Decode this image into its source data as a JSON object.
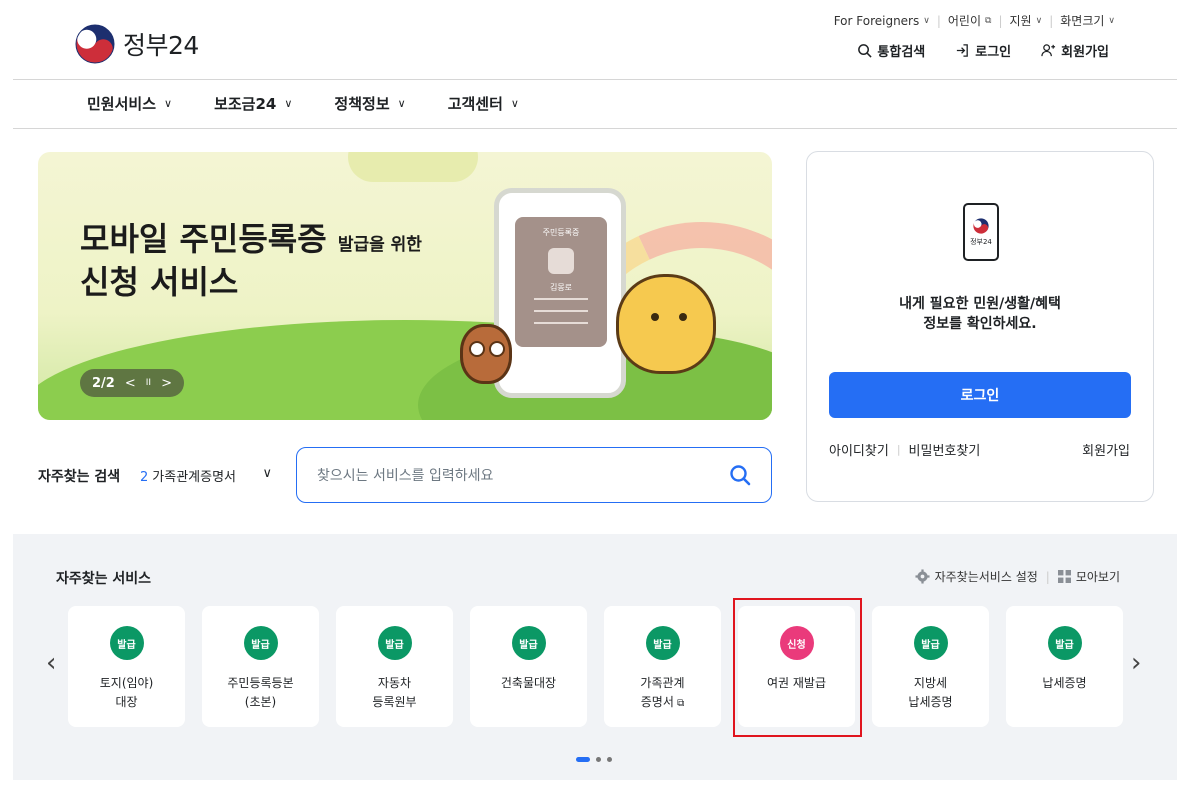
{
  "header": {
    "logo_text": "정부24",
    "util_links": [
      {
        "label": "For Foreigners",
        "suffix": "∨"
      },
      {
        "label": "어린이",
        "suffix": "⧉"
      },
      {
        "label": "지원",
        "suffix": "∨"
      },
      {
        "label": "화면크기",
        "suffix": "∨"
      }
    ],
    "actions": [
      {
        "label": "통합검색",
        "icon": "search-icon"
      },
      {
        "label": "로그인",
        "icon": "login-icon"
      },
      {
        "label": "회원가입",
        "icon": "user-plus-icon"
      }
    ]
  },
  "nav": [
    {
      "label": "민원서비스"
    },
    {
      "label": "보조금24"
    },
    {
      "label": "정책정보"
    },
    {
      "label": "고객센터"
    }
  ],
  "banner": {
    "title_line1": "모바일 주민등록증",
    "title_line1_small": "발급을 위한",
    "title_line2": "신청 서비스",
    "card_title": "주민등록증",
    "card_name": "김몽로",
    "slide_counter": "2/2",
    "prev_symbol": "<",
    "pause_symbol": "II",
    "next_symbol": ">"
  },
  "frequent_search": {
    "label": "자주찾는 검색",
    "rank": "2",
    "keyword": "가족관계증명서",
    "placeholder": "찾으시는 서비스를 입력하세요"
  },
  "login_box": {
    "app_icon_text": "정부24",
    "message_line1": "내게 필요한 민원/생활/혜택",
    "message_line2": "정보를 확인하세요.",
    "login_button": "로그인",
    "find_id": "아이디찾기",
    "find_password": "비밀번호찾기",
    "signup": "회원가입"
  },
  "services": {
    "title": "자주찾는 서비스",
    "settings_label": "자주찾는서비스 설정",
    "view_all_label": "모아보기",
    "prev": "‹",
    "next": "›",
    "items": [
      {
        "badge": "발급",
        "label": "토지(임야)\n대장",
        "badge_color": "#0b9865"
      },
      {
        "badge": "발급",
        "label": "주민등록등본\n(초본)",
        "badge_color": "#0b9865"
      },
      {
        "badge": "발급",
        "label": "자동차\n등록원부",
        "badge_color": "#0b9865"
      },
      {
        "badge": "발급",
        "label": "건축물대장",
        "badge_color": "#0b9865"
      },
      {
        "badge": "발급",
        "label": "가족관계\n증명서",
        "badge_color": "#0b9865",
        "external": true
      },
      {
        "badge": "신청",
        "label": "여권 재발급",
        "badge_color": "#ea3a7b"
      },
      {
        "badge": "발급",
        "label": "지방세\n납세증명",
        "badge_color": "#0b9865"
      },
      {
        "badge": "발급",
        "label": "납세증명",
        "badge_color": "#0b9865"
      }
    ],
    "page_count": 3,
    "active_page": 1
  },
  "colors": {
    "primary": "#256ef4",
    "issue_badge": "#0b9865",
    "apply_badge": "#ea3a7b",
    "highlight_box": "#e0141e"
  }
}
